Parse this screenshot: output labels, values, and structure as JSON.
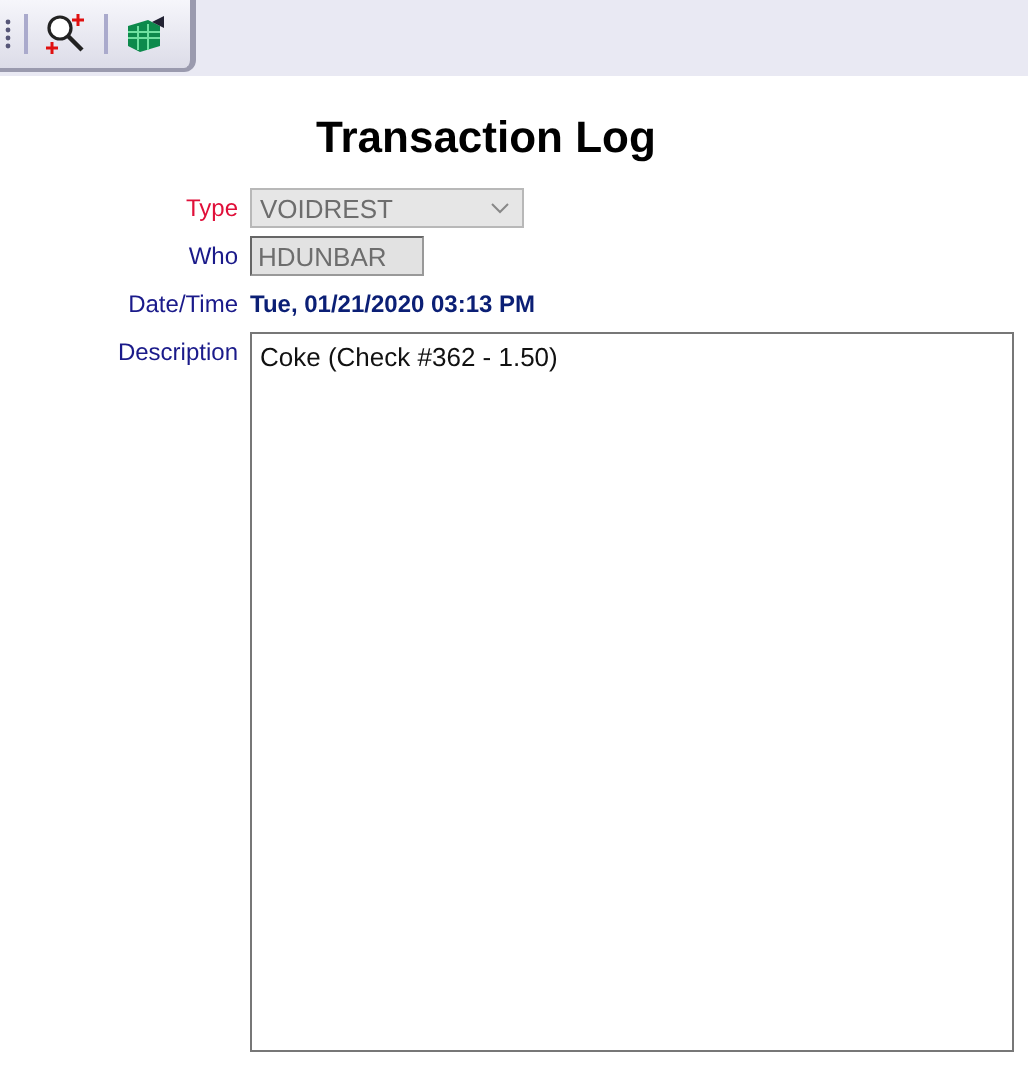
{
  "toolbar": {
    "buttons": [
      {
        "kind": "zoom"
      },
      {
        "kind": "export"
      }
    ]
  },
  "title": "Transaction Log",
  "fields": [
    {
      "kind": "select",
      "label": "Type",
      "required": true,
      "disabled": true,
      "value": "VOIDREST"
    },
    {
      "kind": "input",
      "label": "Who",
      "required": false,
      "disabled": true,
      "value": "HDUNBAR"
    },
    {
      "kind": "text",
      "label": "Date/Time",
      "required": false,
      "value": "Tue, 01/21/2020 03:13 PM"
    },
    {
      "kind": "textarea",
      "label": "Description",
      "required": false,
      "value": "Coke (Check #362 - 1.50)"
    }
  ]
}
